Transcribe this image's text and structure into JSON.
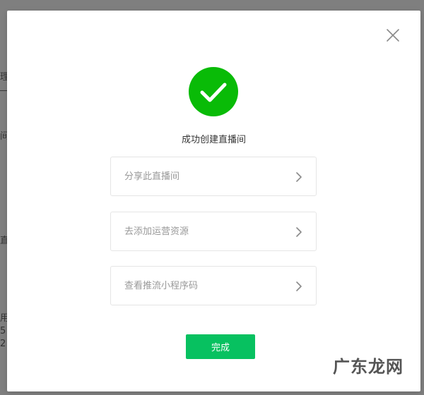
{
  "backdrop": {
    "fragments": [
      "理",
      "间",
      "直",
      "用",
      "5",
      "2"
    ]
  },
  "modal": {
    "close_icon": "close-icon",
    "success_icon": "check-circle-icon",
    "accent_color": "#07c160",
    "title": "成功创建直播间",
    "actions": [
      {
        "label": "分享此直播间",
        "icon": "chevron-right-icon"
      },
      {
        "label": "去添加运营资源",
        "icon": "chevron-right-icon"
      },
      {
        "label": "查看推流小程序码",
        "icon": "chevron-right-icon"
      }
    ],
    "done_label": "完成"
  },
  "watermark": "广东龙网"
}
